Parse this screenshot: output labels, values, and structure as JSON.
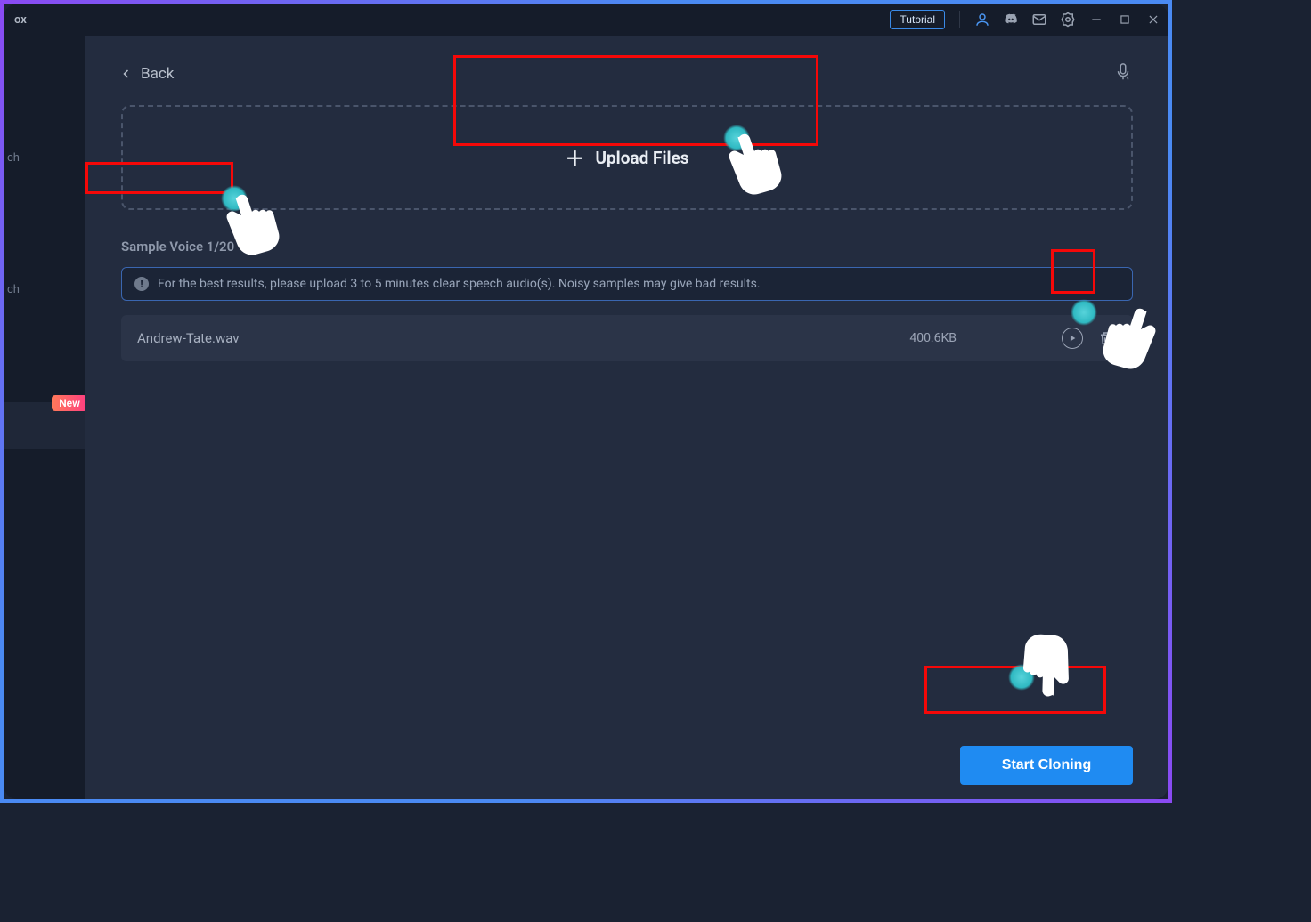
{
  "titlebar": {
    "app_fragment": "ox",
    "tutorial_label": "Tutorial"
  },
  "sidebar": {
    "item_a": "ch",
    "item_b": "ch",
    "badge_new": "New"
  },
  "main": {
    "back_label": "Back",
    "upload_label": "Upload Files",
    "section_title": "Sample Voice 1/20",
    "info_text": "For the best results, please upload 3 to 5 minutes clear speech audio(s). Noisy samples may give bad results.",
    "file": {
      "name": "Andrew-Tate.wav",
      "size": "400.6KB"
    },
    "start_label": "Start Cloning"
  }
}
